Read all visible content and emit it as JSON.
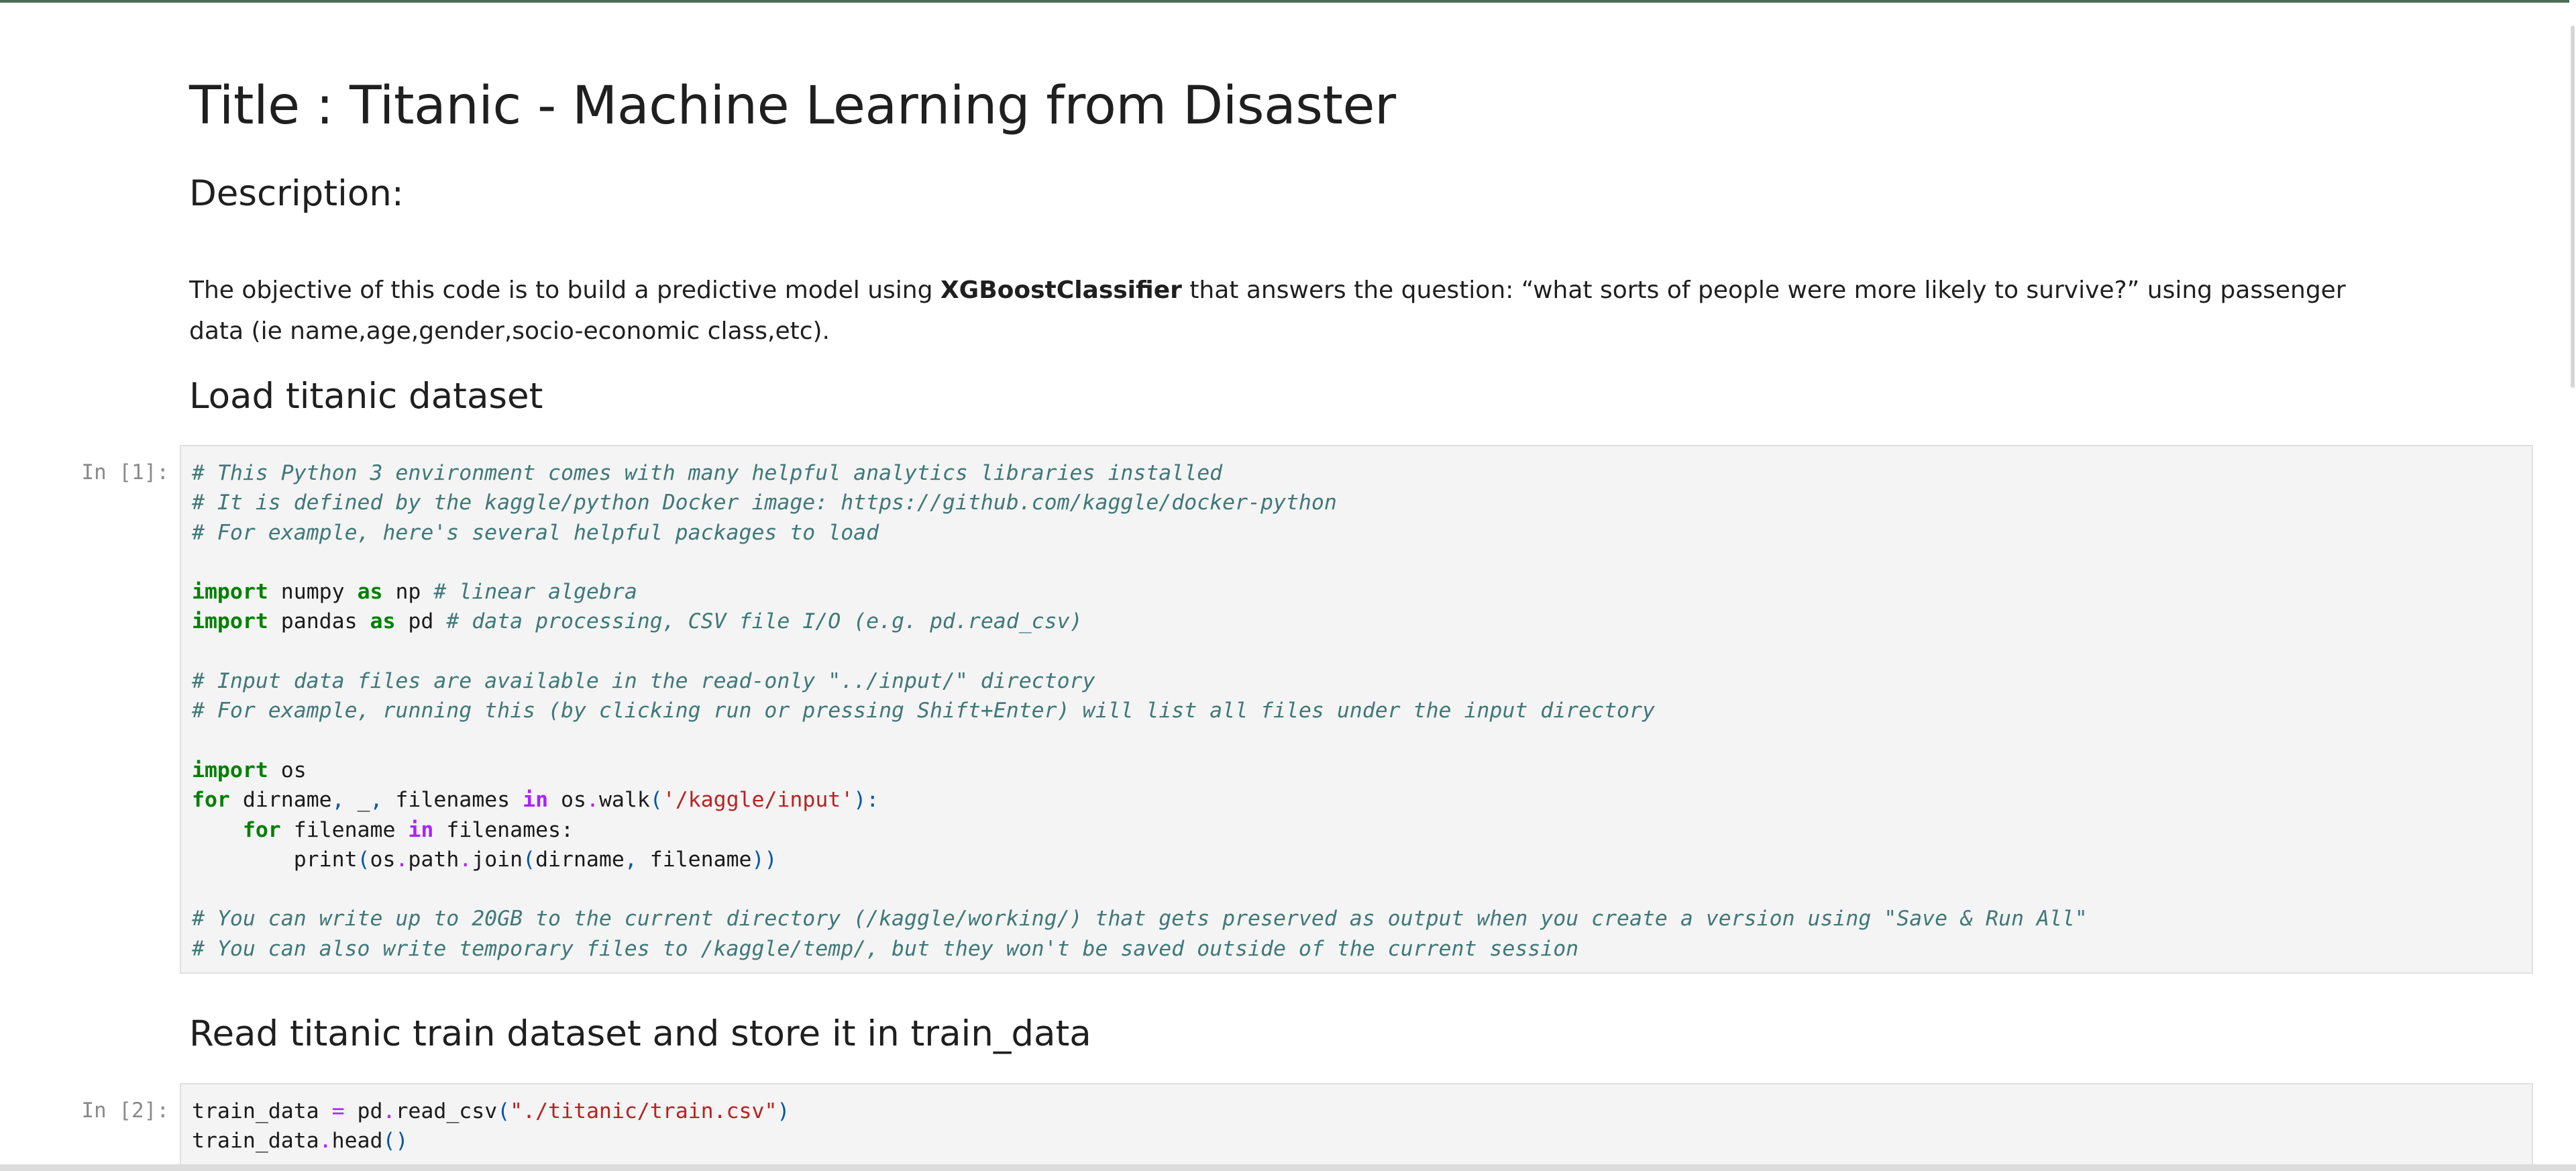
{
  "markdown": {
    "title": "Title : Titanic - Machine Learning from Disaster",
    "description_heading": "Description:",
    "description_pre": "The objective of this code is to build a predictive model using ",
    "description_bold": "XGBoostClassifier",
    "description_post": " that answers the question: “what sorts of people were more likely to survive?” using passenger data (ie name,age,gender,socio-economic class,etc).",
    "load_heading": "Load titanic dataset",
    "read_heading": "Read titanic train dataset and store it in train_data"
  },
  "cells": [
    {
      "prompt": "In [1]:",
      "lines": [
        [
          {
            "t": "c",
            "v": "# This Python 3 environment comes with many helpful analytics libraries installed"
          }
        ],
        [
          {
            "t": "c",
            "v": "# It is defined by the kaggle/python Docker image: https://github.com/kaggle/docker-python"
          }
        ],
        [
          {
            "t": "c",
            "v": "# For example, here's several helpful packages to load"
          }
        ],
        [],
        [
          {
            "t": "k",
            "v": "import"
          },
          {
            "t": "n",
            "v": " numpy "
          },
          {
            "t": "k",
            "v": "as"
          },
          {
            "t": "n",
            "v": " np "
          },
          {
            "t": "c",
            "v": "# linear algebra"
          }
        ],
        [
          {
            "t": "k",
            "v": "import"
          },
          {
            "t": "n",
            "v": " pandas "
          },
          {
            "t": "k",
            "v": "as"
          },
          {
            "t": "n",
            "v": " pd "
          },
          {
            "t": "c",
            "v": "# data processing, CSV file I/O (e.g. pd.read_csv)"
          }
        ],
        [],
        [
          {
            "t": "c",
            "v": "# Input data files are available in the read-only \"../input/\" directory"
          }
        ],
        [
          {
            "t": "c",
            "v": "# For example, running this (by clicking run or pressing Shift+Enter) will list all files under the input directory"
          }
        ],
        [],
        [
          {
            "t": "k",
            "v": "import"
          },
          {
            "t": "n",
            "v": " os"
          }
        ],
        [
          {
            "t": "k",
            "v": "for"
          },
          {
            "t": "n",
            "v": " dirname"
          },
          {
            "t": "p",
            "v": ","
          },
          {
            "t": "n",
            "v": " _"
          },
          {
            "t": "p",
            "v": ","
          },
          {
            "t": "n",
            "v": " filenames "
          },
          {
            "t": "kp",
            "v": "in"
          },
          {
            "t": "n",
            "v": " os"
          },
          {
            "t": "o",
            "v": "."
          },
          {
            "t": "n",
            "v": "walk"
          },
          {
            "t": "p",
            "v": "("
          },
          {
            "t": "s",
            "v": "'/kaggle/input'"
          },
          {
            "t": "p",
            "v": "):"
          }
        ],
        [
          {
            "t": "n",
            "v": "    "
          },
          {
            "t": "k",
            "v": "for"
          },
          {
            "t": "n",
            "v": " filename "
          },
          {
            "t": "kp",
            "v": "in"
          },
          {
            "t": "n",
            "v": " filenames:"
          }
        ],
        [
          {
            "t": "n",
            "v": "        print"
          },
          {
            "t": "p",
            "v": "("
          },
          {
            "t": "n",
            "v": "os"
          },
          {
            "t": "o",
            "v": "."
          },
          {
            "t": "n",
            "v": "path"
          },
          {
            "t": "o",
            "v": "."
          },
          {
            "t": "n",
            "v": "join"
          },
          {
            "t": "p",
            "v": "("
          },
          {
            "t": "n",
            "v": "dirname"
          },
          {
            "t": "p",
            "v": ","
          },
          {
            "t": "n",
            "v": " filename"
          },
          {
            "t": "p",
            "v": "))"
          }
        ],
        [],
        [
          {
            "t": "c",
            "v": "# You can write up to 20GB to the current directory (/kaggle/working/) that gets preserved as output when you create a version using \"Save & Run All\""
          }
        ],
        [
          {
            "t": "c",
            "v": "# You can also write temporary files to /kaggle/temp/, but they won't be saved outside of the current session"
          }
        ]
      ]
    },
    {
      "prompt": "In [2]:",
      "lines": [
        [
          {
            "t": "n",
            "v": "train_data "
          },
          {
            "t": "o",
            "v": "="
          },
          {
            "t": "n",
            "v": " pd"
          },
          {
            "t": "o",
            "v": "."
          },
          {
            "t": "n",
            "v": "read_csv"
          },
          {
            "t": "p",
            "v": "("
          },
          {
            "t": "s",
            "v": "\"./titanic/train.csv\""
          },
          {
            "t": "p",
            "v": ")"
          }
        ],
        [
          {
            "t": "n",
            "v": "train_data"
          },
          {
            "t": "o",
            "v": "."
          },
          {
            "t": "n",
            "v": "head"
          },
          {
            "t": "p",
            "v": "()"
          }
        ]
      ]
    }
  ],
  "colors": {
    "comment": "#3f7878",
    "keyword": "#008000",
    "operator_keyword": "#aa22ff",
    "string": "#ba2121",
    "cell_background": "#f4f4f4",
    "prompt": "#8a8a8a"
  }
}
